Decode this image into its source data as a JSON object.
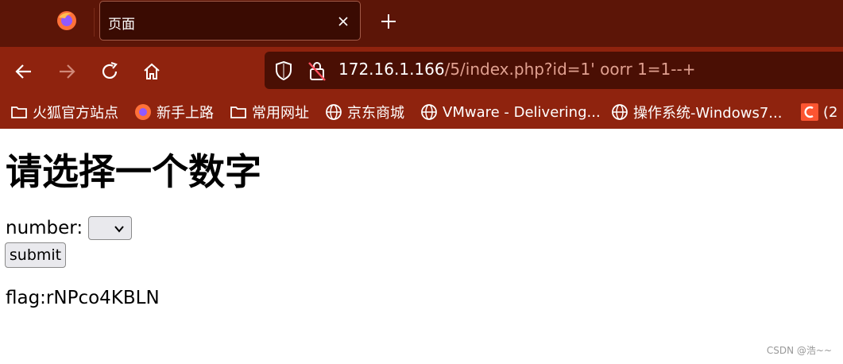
{
  "browser": {
    "tab": {
      "title": "页面"
    },
    "address": {
      "host": "172.16.1.166",
      "path": "/5/index.php?id=1' oorr 1=1--+"
    },
    "bookmarks": [
      {
        "label": "火狐官方站点",
        "icon": "folder-icon"
      },
      {
        "label": "新手上路",
        "icon": "firefox-icon"
      },
      {
        "label": "常用网址",
        "icon": "folder-icon"
      },
      {
        "label": "京东商城",
        "icon": "globe-icon"
      },
      {
        "label": "VMware - Delivering...",
        "icon": "globe-icon"
      },
      {
        "label": "操作系统-Windows7...",
        "icon": "globe-icon"
      },
      {
        "label": "(2",
        "icon": "csdn-icon"
      }
    ],
    "colors": {
      "tabstrip": "#5c1507",
      "toolbar": "#8f230e",
      "urlbar": "#4a0f04"
    }
  },
  "page": {
    "heading": "请选择一个数字",
    "form": {
      "label": "number:",
      "select_value": "",
      "submit_label": "submit"
    },
    "flag_text": "flag:rNPco4KBLN",
    "watermark": "CSDN @浩~~"
  }
}
